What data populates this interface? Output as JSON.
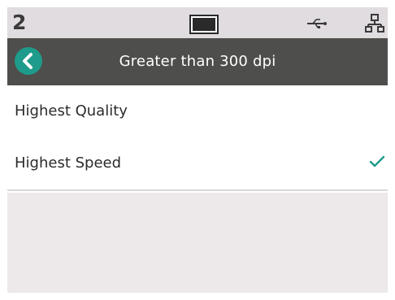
{
  "status_bar": {
    "number": "2",
    "icons": [
      "screen-icon",
      "usb-icon",
      "network-icon"
    ]
  },
  "header": {
    "back_icon": "chevron-left-icon",
    "title": "Greater than 300 dpi"
  },
  "options": [
    {
      "label": "Highest Quality",
      "selected": false
    },
    {
      "label": "Highest Speed",
      "selected": true
    }
  ],
  "colors": {
    "status_bar_bg": "#e0dcdf",
    "header_bg": "#4e4e4c",
    "accent": "#1e9b8a",
    "empty_bg": "#ede8ea"
  }
}
